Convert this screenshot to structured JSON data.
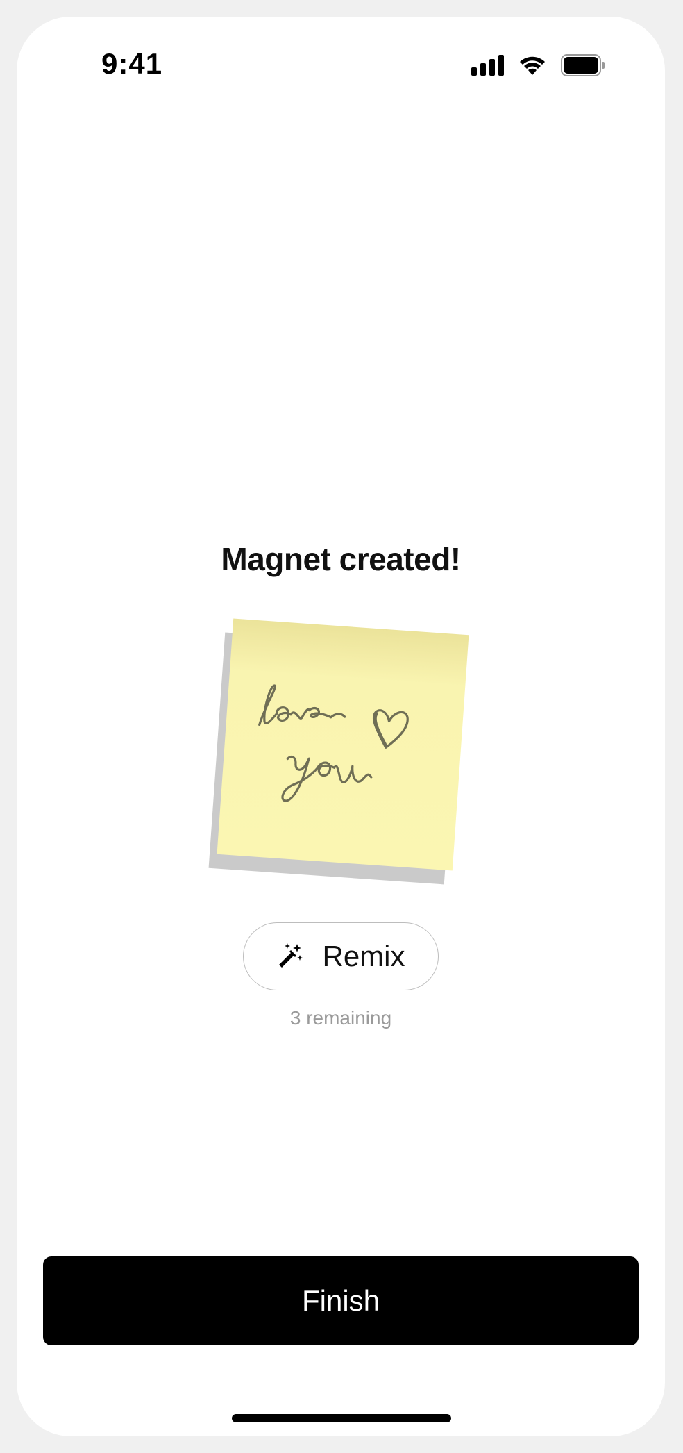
{
  "status_bar": {
    "time": "9:41",
    "icons": [
      "cellular-signal-icon",
      "wifi-icon",
      "battery-icon"
    ]
  },
  "main": {
    "title": "Magnet created!",
    "note": {
      "handwriting": "love you",
      "color": "#fbf6b2"
    },
    "remix": {
      "label": "Remix",
      "icon": "magic-wand-icon",
      "remaining": "3 remaining"
    }
  },
  "footer": {
    "finish_label": "Finish"
  },
  "colors": {
    "primary_button": "#000000",
    "note_yellow": "#fbf6b2",
    "muted_text": "#9a9a9a"
  }
}
